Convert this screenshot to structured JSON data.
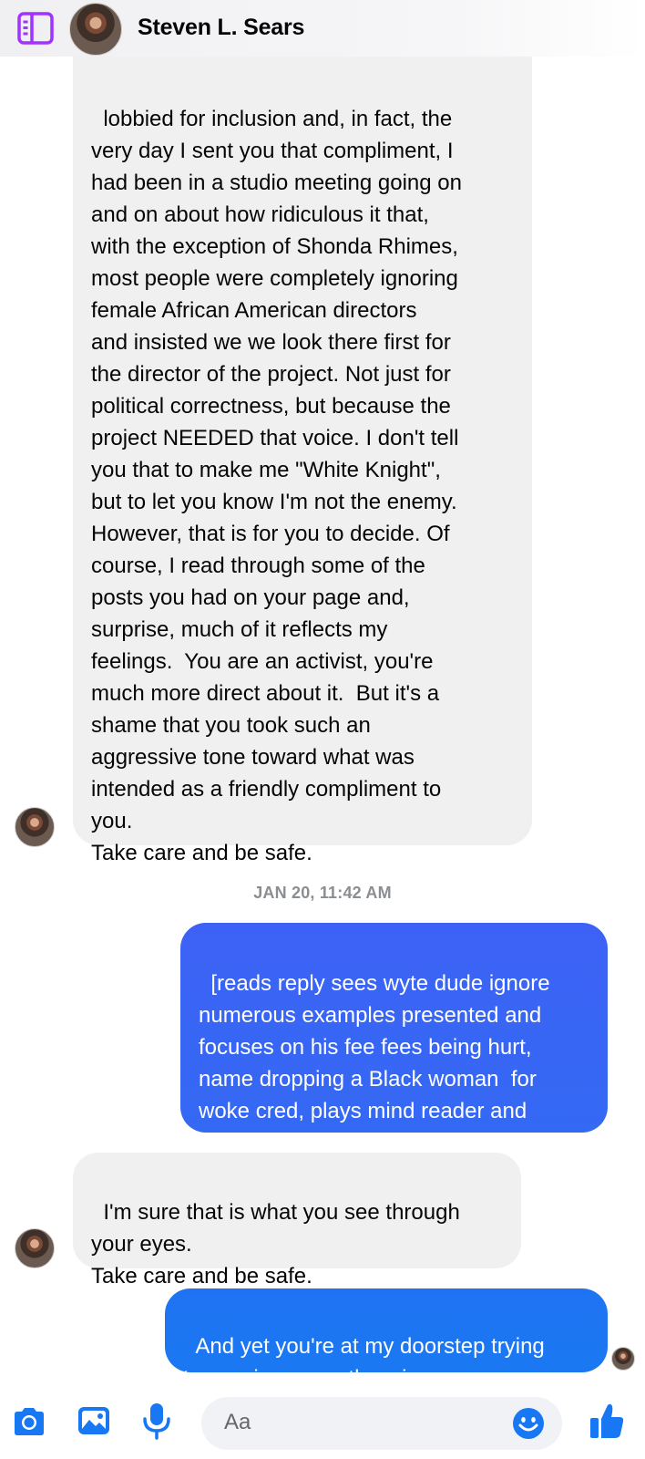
{
  "header": {
    "contact_name": "Steven L. Sears",
    "sidebar_icon": "sidebar-panel-icon",
    "accent_color": "#a033ff"
  },
  "messages": [
    {
      "sender": "contact",
      "text": "lobbied for inclusion and, in fact, the\nvery day I sent you that compliment, I\nhad been in a studio meeting going on\nand on about how ridiculous it that,\nwith the exception of Shonda Rhimes,\nmost people were completely ignoring\nfemale African American directors\nand insisted we we look there first for\nthe director of the project. Not just for\npolitical correctness, but because the\nproject NEEDED that voice. I don't tell\nyou that to make me \"White Knight\",\nbut to let you know I'm not the enemy.\nHowever, that is for you to decide. Of\ncourse, I read through some of the\nposts you had on your page and,\nsurprise, much of it reflects my\nfeelings.  You are an activist, you're\nmuch more direct about it.  But it's a\nshame that you took such an\naggressive tone toward what was\nintended as a friendly compliment to\nyou.\nTake care and be safe."
    },
    {
      "sender": "me",
      "text": "[reads reply sees wyte dude ignore\nnumerous examples presented and\nfocuses on his fee fees being hurt,\nname dropping a Black woman  for\nwoke cred, plays mind reader and\ndoes the cliched evasive behavior.]"
    },
    {
      "sender": "contact",
      "text": "I'm sure that is what you see through\nyour eyes.\nTake care and be safe."
    },
    {
      "sender": "me",
      "text": "And yet you're at my doorstep trying\nto convince me otherwise so..."
    }
  ],
  "timestamp": "JAN 20, 11:42 AM",
  "composer": {
    "placeholder": "Aa",
    "icons": [
      "camera-icon",
      "photo-icon",
      "microphone-icon",
      "emoji-icon",
      "thumbs-up-icon"
    ],
    "accent_color": "#1877f2"
  },
  "colors": {
    "incoming_bubble": "#f0f0f0",
    "outgoing_bubble_top": "#3d62f5",
    "outgoing_bubble_bottom": "#1a78f2"
  }
}
